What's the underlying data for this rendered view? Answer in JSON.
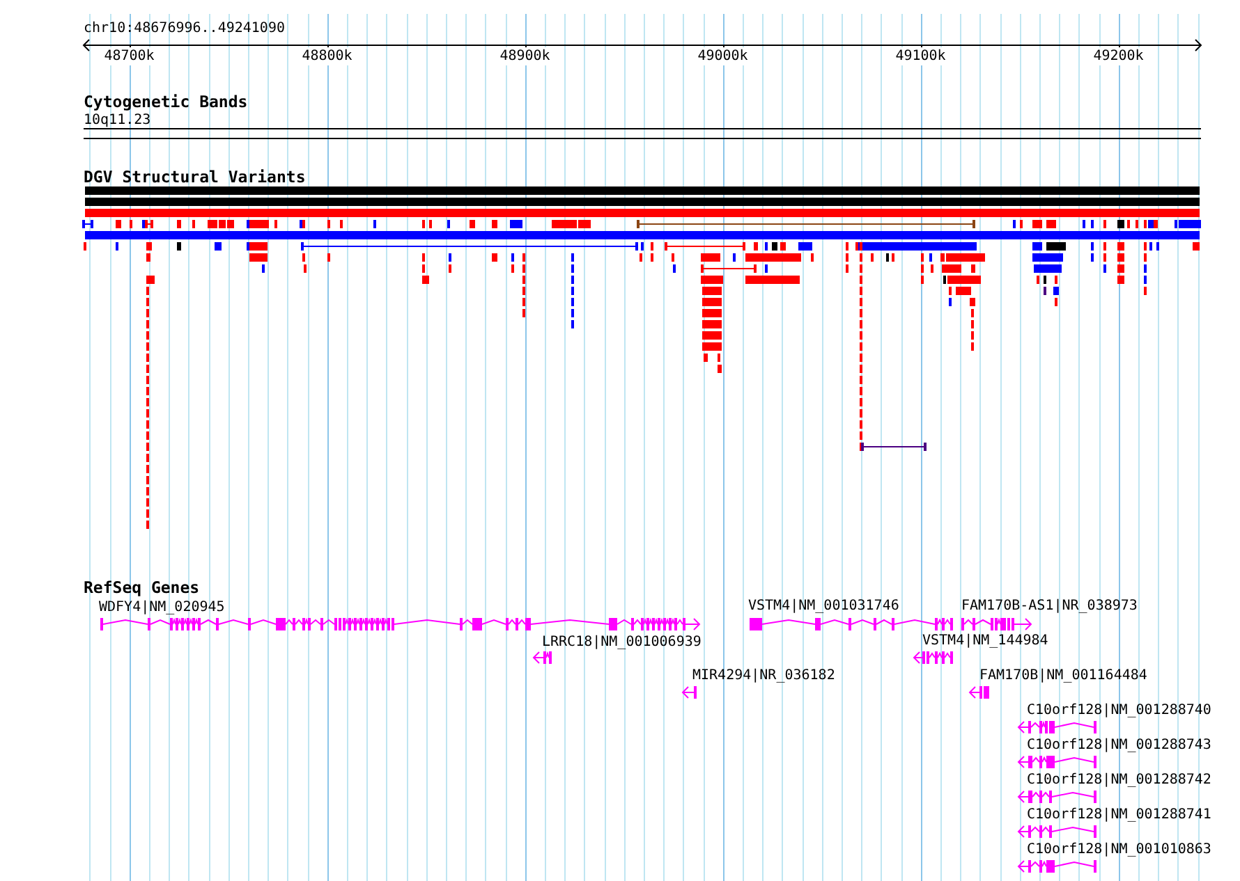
{
  "ruler": {
    "position": "chr10:48676996..49241090",
    "ticks": [
      "48700k",
      "48800k",
      "48900k",
      "49000k",
      "49100k",
      "49200k"
    ]
  },
  "tracks": [
    {
      "kind": "bands",
      "title": "Cytogenetic Bands",
      "label": "10q11.23"
    },
    {
      "kind": "variants",
      "title": "DGV Structural Variants"
    },
    {
      "kind": "genes",
      "title": "RefSeq Genes",
      "genes": [
        {
          "label": "WDFY4|NM_020945"
        },
        {
          "label": "LRRC18|NM_001006939"
        },
        {
          "label": "MIR4294|NR_036182"
        },
        {
          "label": "VSTM4|NM_001031746"
        },
        {
          "label": "FAM170B-AS1|NR_038973"
        },
        {
          "label": "VSTM4|NM_144984"
        },
        {
          "label": "FAM170B|NM_001164484"
        },
        {
          "label": "C10orf128|NM_001288740"
        },
        {
          "label": "C10orf128|NM_001288743"
        },
        {
          "label": "C10orf128|NM_001288742"
        },
        {
          "label": "C10orf128|NM_001288741"
        },
        {
          "label": "C10orf128|NM_001010863"
        }
      ]
    }
  ]
}
